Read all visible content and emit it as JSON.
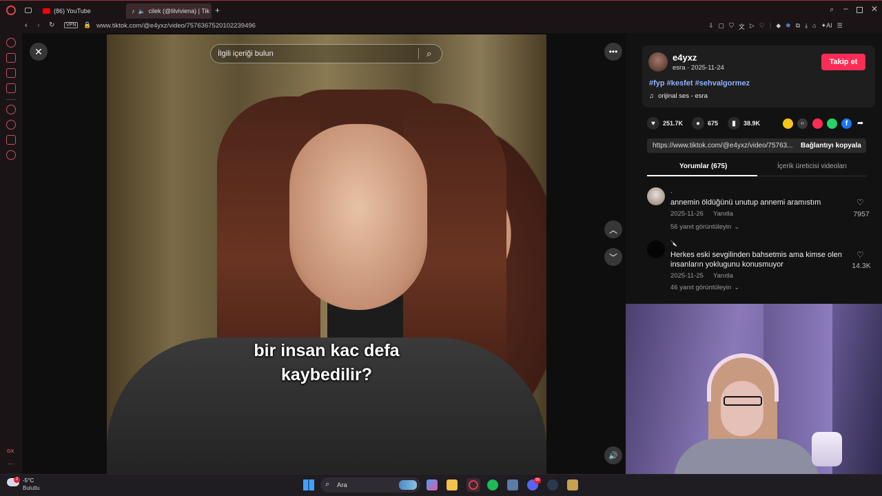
{
  "browser": {
    "tabs": [
      {
        "label": "(86) YouTube"
      },
      {
        "label": "cilek (@lilviviena) | Tik"
      }
    ],
    "new_tab": "+",
    "vpn_badge": "VPN",
    "url": "www.tiktok.com/@e4yxz/video/7576367520102239496",
    "ai_label": "AI"
  },
  "sidebar": {
    "gx_label": "GX",
    "more": "···"
  },
  "video": {
    "search_placeholder": "İlgili içeriği bulun",
    "subtitle_line1": "bir insan kac defa",
    "subtitle_line2": "kaybedilir?"
  },
  "author": {
    "username": "e4yxz",
    "meta": "esra · 2025-11-24",
    "follow_label": "Takip et",
    "hashtags": "#fyp #kesfet #sehvalgormez",
    "sound": "orijinal ses - esra"
  },
  "stats": {
    "likes": "251.7K",
    "comments": "675",
    "saves": "38.9K"
  },
  "share": {
    "link": "https://www.tiktok.com/@e4yxz/video/75763...",
    "copy_label": "Bağlantıyı kopyala",
    "colors": {
      "coin": "#f5c518",
      "embed": "#3a3a3a",
      "send": "#fe2c55",
      "whatsapp": "#25d366",
      "facebook": "#1877f2"
    }
  },
  "tabs": {
    "comments": "Yorumlar (675)",
    "creator_videos": "İçerik üreticisi videoları"
  },
  "comments": [
    {
      "username": ".",
      "text": "annemin öldüğünü unutup annemi aramıstım",
      "date": "2025-11-26",
      "reply": "Yanıtla",
      "view_replies": "56 yanıt görüntüleyin",
      "likes": "7957"
    },
    {
      "username": "🔪",
      "text_line1": "Herkes eski sevgilinden bahsetmis ama kimse olen",
      "text_line2": "insanların yoklugunu konusmuyor",
      "date": "2025-11-25",
      "reply": "Yanıtla",
      "view_replies": "46 yanıt görüntüleyin",
      "likes": "14.3K"
    }
  ],
  "taskbar": {
    "weather_temp": "-5°C",
    "weather_desc": "Bulutlu",
    "weather_badge": "2",
    "search_label": "Ara",
    "discord_badge": "99"
  }
}
